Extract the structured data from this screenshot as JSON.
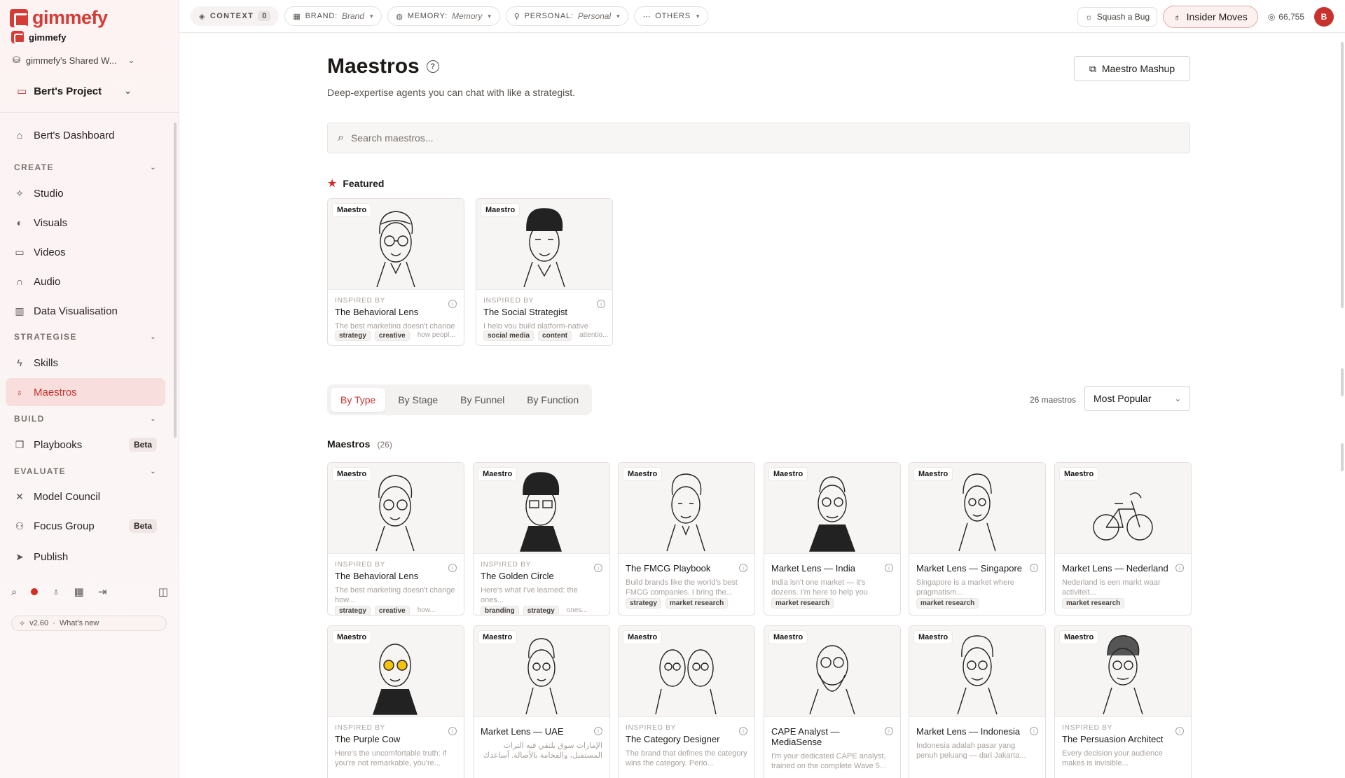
{
  "brand": {
    "name": "gimmefy",
    "name_small": "gimmefy"
  },
  "sidebar": {
    "workspace": "gimmefy's Shared W...",
    "project": "Bert's Project",
    "dashboard": "Bert's Dashboard",
    "sections": {
      "create": "CREATE",
      "strategise": "STRATEGISE",
      "build": "BUILD",
      "evaluate": "EVALUATE"
    },
    "create_items": [
      "Studio",
      "Visuals",
      "Videos",
      "Audio",
      "Data Visualisation"
    ],
    "strategise_items": [
      "Skills",
      "Maestros"
    ],
    "build_items": [
      {
        "label": "Playbooks",
        "badge": "Beta"
      }
    ],
    "evaluate_items": [
      {
        "label": "Model Council",
        "badge": ""
      },
      {
        "label": "Focus Group",
        "badge": "Beta"
      },
      {
        "label": "Publish",
        "badge": ""
      }
    ],
    "version": "v2.60",
    "whats_new": "What's new"
  },
  "topbar": {
    "context_label": "CONTEXT",
    "context_count": "0",
    "brand_label": "BRAND:",
    "brand_value": "Brand",
    "memory_label": "MEMORY:",
    "memory_value": "Memory",
    "personal_label": "PERSONAL:",
    "personal_value": "Personal",
    "others_label": "OTHERS",
    "squash_bug": "Squash a Bug",
    "insider_moves": "Insider Moves",
    "credits": "66,755",
    "avatar_initial": "B"
  },
  "page": {
    "title": "Maestros",
    "subtitle": "Deep-expertise agents you can chat with like a strategist.",
    "mashup_button": "Maestro Mashup",
    "search_placeholder": "Search maestros...",
    "featured_label": "Featured",
    "tabs": [
      "By Type",
      "By Stage",
      "By Funnel",
      "By Function"
    ],
    "count_text": "26 maestros",
    "sort_value": "Most Popular",
    "list_heading": "Maestros",
    "list_count": "(26)"
  },
  "featured": [
    {
      "tag": "Maestro",
      "inspired": "INSPIRED BY",
      "name": "The Behavioral Lens",
      "desc": "The best marketing doesn't change how peopl...",
      "tags": [
        "strategy",
        "creative",
        "how peopl..."
      ]
    },
    {
      "tag": "Maestro",
      "inspired": "INSPIRED BY",
      "name": "The Social Strategist",
      "desc": "I help you build platform-native attentio...",
      "tags": [
        "social media",
        "content",
        "attentio..."
      ]
    }
  ],
  "maestros": [
    {
      "tag": "Maestro",
      "inspired": "INSPIRED BY",
      "name": "The Behavioral Lens",
      "desc": "The best marketing doesn't change how...",
      "tags": [
        "strategy",
        "creative",
        "how..."
      ]
    },
    {
      "tag": "Maestro",
      "inspired": "INSPIRED BY",
      "name": "The Golden Circle",
      "desc": "Here's what I've learned: the ones...",
      "tags": [
        "branding",
        "strategy",
        "ones..."
      ]
    },
    {
      "tag": "Maestro",
      "inspired": "",
      "name": "The FMCG Playbook",
      "desc": "Build brands like the world's best FMCG companies. I bring the...",
      "tags": [
        "strategy",
        "market research"
      ]
    },
    {
      "tag": "Maestro",
      "inspired": "",
      "name": "Market Lens — India",
      "desc": "India isn't one market — it's dozens. I'm here to help you navigate the...",
      "tags": [
        "market research"
      ]
    },
    {
      "tag": "Maestro",
      "inspired": "",
      "name": "Market Lens — Singapore",
      "desc": "Singapore is a market where pragmatism...",
      "tags": [
        "market research"
      ]
    },
    {
      "tag": "Maestro",
      "inspired": "",
      "name": "Market Lens — Nederland",
      "desc": "Nederland is een markt waar activiteit...",
      "tags": [
        "market research"
      ]
    },
    {
      "tag": "Maestro",
      "inspired": "INSPIRED BY",
      "name": "The Purple Cow",
      "desc": "Here's the uncomfortable truth: if you're not remarkable, you're...",
      "tags": []
    },
    {
      "tag": "Maestro",
      "inspired": "",
      "name": "Market Lens — UAE",
      "desc": "الإمارات سوق يلتقي فيه التراث المستقبل، والفخامة بالأصالة. أساعدك",
      "tags": []
    },
    {
      "tag": "Maestro",
      "inspired": "INSPIRED BY",
      "name": "The Category Designer",
      "desc": "The brand that defines the category wins the category. Perio...",
      "tags": []
    },
    {
      "tag": "Maestro",
      "inspired": "",
      "name": "CAPE Analyst — MediaSense",
      "desc": "I'm your dedicated CAPE analyst, trained on the complete Wave 5...",
      "tags": []
    },
    {
      "tag": "Maestro",
      "inspired": "",
      "name": "Market Lens — Indonesia",
      "desc": "Indonesia adalah pasar yang penuh peluang — dari Jakarta...",
      "tags": []
    },
    {
      "tag": "Maestro",
      "inspired": "INSPIRED BY",
      "name": "The Persuasion Architect",
      "desc": "Every decision your audience makes is invisible...",
      "tags": []
    }
  ],
  "colors": {
    "accent": "#c8322d",
    "brand": "#d63c36",
    "active_bg": "#f8dedd"
  }
}
